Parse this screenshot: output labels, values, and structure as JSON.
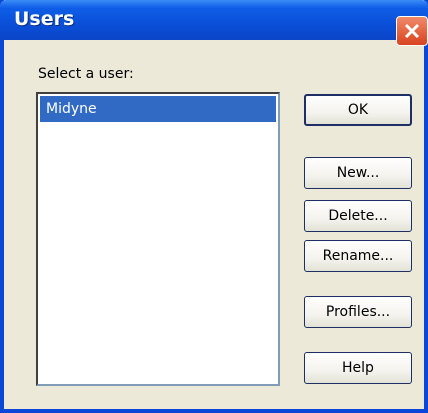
{
  "window": {
    "title": "Users"
  },
  "dialog": {
    "select_label": "Select a user:",
    "users": [
      "Midyne"
    ],
    "selected_user": "Midyne"
  },
  "buttons": {
    "ok": "OK",
    "new": "New...",
    "delete": "Delete...",
    "rename": "Rename...",
    "profiles": "Profiles...",
    "help": "Help"
  },
  "icons": {
    "close": "close-icon"
  },
  "colors": {
    "titlebar": "#0a4fd8",
    "selection": "#316ac5",
    "close_button": "#d8431f",
    "dialog_bg": "#ece9d8"
  }
}
